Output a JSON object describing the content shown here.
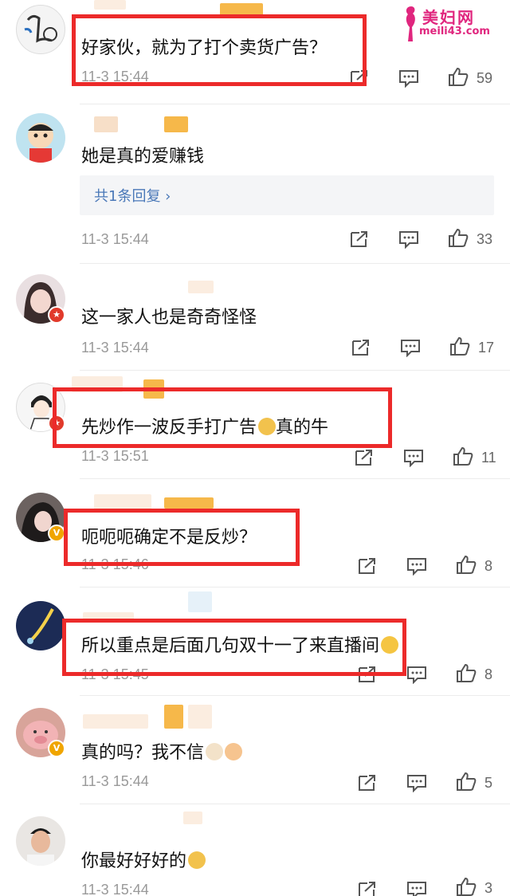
{
  "watermark": {
    "site_name": "美妇网",
    "site_url": "meili43.com"
  },
  "comments": [
    {
      "text": "好家伙，就为了打个卖货广告？",
      "time": "11-3 15:44",
      "likes": "59"
    },
    {
      "text": "她是真的爱赚钱",
      "time": "11-3 15:44",
      "likes": "33",
      "reply_label": "共1条回复 ›"
    },
    {
      "text": "这一家人也是奇奇怪怪",
      "time": "11-3 15:44",
      "likes": "17"
    },
    {
      "text": "先炒作一波反手打广告",
      "text_after": "真的牛",
      "time": "11-3 15:51",
      "likes": "11"
    },
    {
      "text": "呃呃呃确定不是反炒？",
      "time": "11-3 15:46",
      "likes": "8"
    },
    {
      "text": "所以重点是后面几句双十一了来直播间",
      "time": "11-3 15:45",
      "likes": "8"
    },
    {
      "text": "真的吗？我不信",
      "time": "11-3 15:44",
      "likes": "5"
    },
    {
      "text": "你最好好好的",
      "time": "11-3 15:44",
      "likes": "3"
    }
  ],
  "colors": {
    "highlight": "#ec2a2a",
    "time": "#999999",
    "reply_link": "#4a78b8",
    "watermark": "#e0267e"
  },
  "icons": [
    "share-icon",
    "comment-icon",
    "like-icon"
  ]
}
